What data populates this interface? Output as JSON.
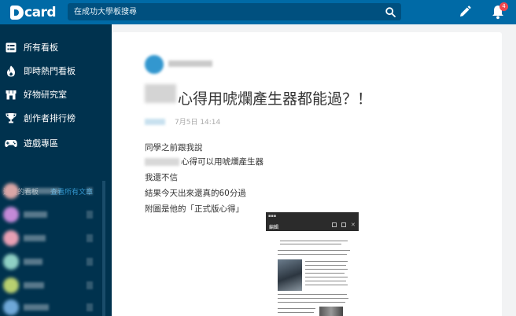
{
  "header": {
    "logo_text": "card",
    "search_placeholder": "在成功大學板搜尋",
    "notification_count": "4",
    "icons": [
      "logo-icon",
      "search-icon",
      "pencil-icon",
      "bell-icon"
    ]
  },
  "sidebar": {
    "nav": [
      {
        "label": "所有看板",
        "icon": "list-icon"
      },
      {
        "label": "即時熱門看板",
        "icon": "flame-icon"
      },
      {
        "label": "好物研究室",
        "icon": "store-icon"
      },
      {
        "label": "創作者排行榜",
        "icon": "trophy-icon"
      },
      {
        "label": "遊戲專區",
        "icon": "gamepad-icon"
      }
    ],
    "followed_header": "追蹤的看板",
    "view_all": "查看所有文章"
  },
  "post": {
    "title": "心得用唬爛產生器都能過？！",
    "meta": "7月5日 14:14",
    "body": {
      "line1": "同學之前跟我說",
      "line2": "心得可以用唬爛產生器",
      "line3": "我還不信",
      "line4": "結果今天出來還真的60分過",
      "line5": "附圖是他的「正式版心得」"
    },
    "image": {
      "edit_label": "編輯"
    }
  },
  "colors": {
    "header_bg": "#006aa6",
    "sidebar_bg": "#00324e",
    "content_bg": "#f2f3f4",
    "accent": "#3397cf",
    "badge": "#f0474e"
  }
}
